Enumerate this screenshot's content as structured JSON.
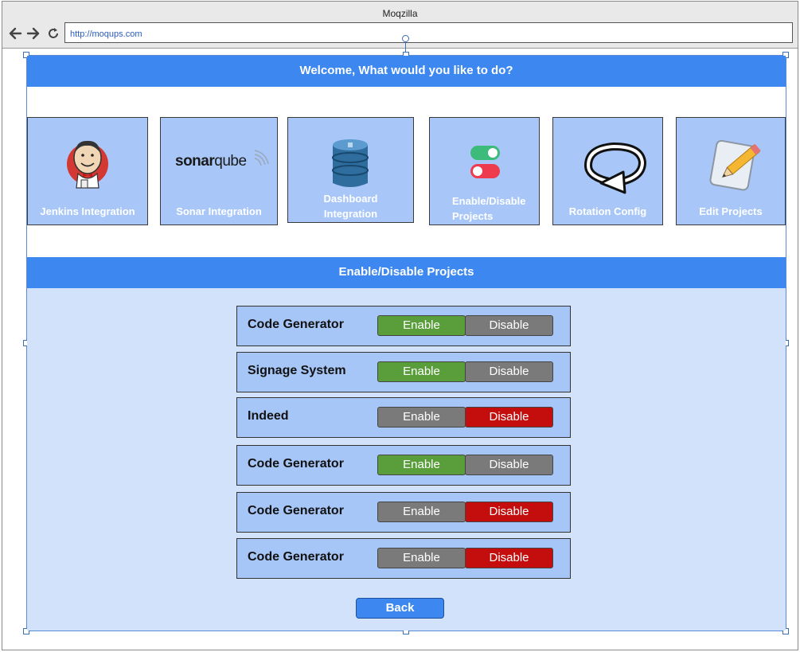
{
  "browser": {
    "title": "Moqzilla",
    "url": "http://moqups.com"
  },
  "header": {
    "welcome": "Welcome, What would you like to do?"
  },
  "tiles": [
    {
      "label": "Jenkins Integration",
      "icon": "jenkins-icon"
    },
    {
      "label": "Sonar Integration",
      "icon": "sonarqube-logo",
      "logo_text_sonar": "sonar",
      "logo_text_qube": "qube"
    },
    {
      "label_line1": "Dashboard",
      "label_line2": "Integration",
      "icon": "database-icon"
    },
    {
      "label_line1": "Enable/Disable",
      "label_line2": "Projects",
      "icon": "toggle-icon"
    },
    {
      "label": "Rotation Config",
      "icon": "rotation-arrow-icon"
    },
    {
      "label": "Edit Projects",
      "icon": "pencil-notepad-icon"
    }
  ],
  "section": {
    "title": "Enable/Disable Projects"
  },
  "projects": [
    {
      "name": "Code Generator",
      "enable_label": "Enable",
      "disable_label": "Disable",
      "state": "enabled"
    },
    {
      "name": "Signage System",
      "enable_label": "Enable",
      "disable_label": "Disable",
      "state": "enabled"
    },
    {
      "name": "Indeed",
      "enable_label": "Enable",
      "disable_label": "Disable",
      "state": "disabled"
    },
    {
      "name": "Code Generator",
      "enable_label": "Enable",
      "disable_label": "Disable",
      "state": "enabled"
    },
    {
      "name": "Code Generator",
      "enable_label": "Enable",
      "disable_label": "Disable",
      "state": "disabled"
    },
    {
      "name": "Code Generator",
      "enable_label": "Enable",
      "disable_label": "Disable",
      "state": "disabled"
    }
  ],
  "back_label": "Back",
  "colors": {
    "accent": "#3d88f0",
    "tile_bg": "#a8c7f8",
    "panel_bg": "#d2e2fb",
    "enabled_green": "#5a9e3c",
    "disabled_red": "#c40e0e",
    "inactive_gray": "#7a7a7a"
  }
}
